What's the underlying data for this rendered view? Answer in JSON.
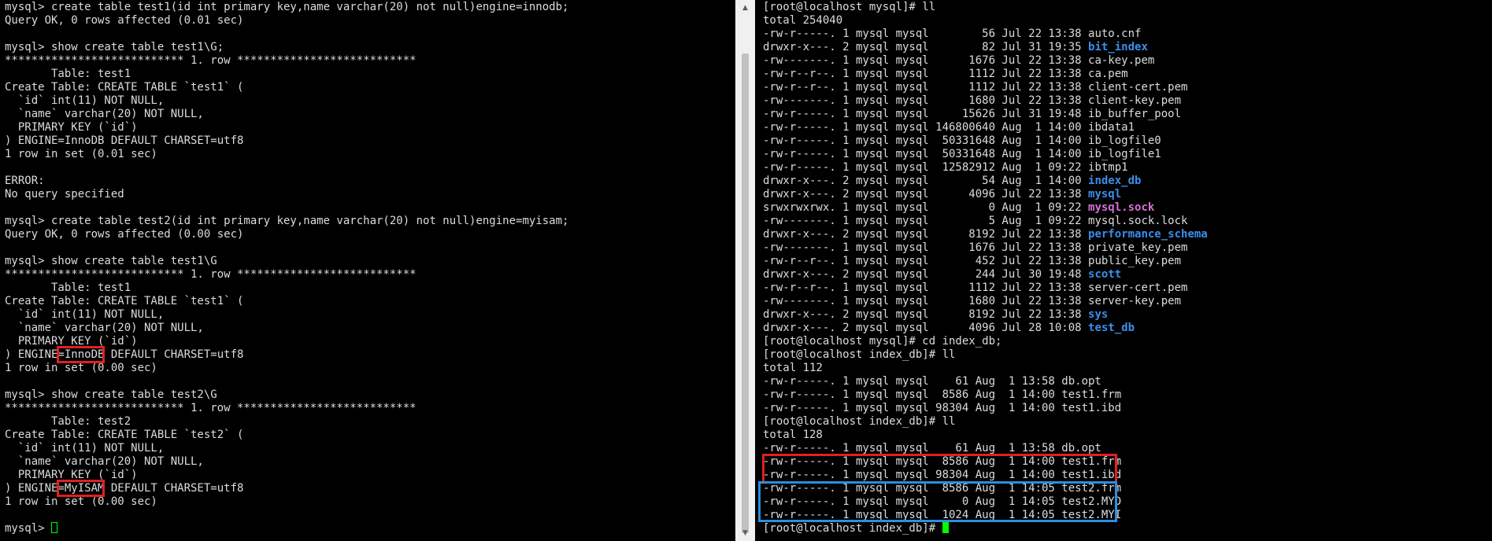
{
  "left_terminal": {
    "lines": [
      "mysql> create table test1(id int primary key,name varchar(20) not null)engine=innodb;",
      "Query OK, 0 rows affected (0.01 sec)",
      "",
      "mysql> show create table test1\\G;",
      "*************************** 1. row ***************************",
      "       Table: test1",
      "Create Table: CREATE TABLE `test1` (",
      "  `id` int(11) NOT NULL,",
      "  `name` varchar(20) NOT NULL,",
      "  PRIMARY KEY (`id`)",
      ") ENGINE=InnoDB DEFAULT CHARSET=utf8",
      "1 row in set (0.01 sec)",
      "",
      "ERROR:",
      "No query specified",
      "",
      "mysql> create table test2(id int primary key,name varchar(20) not null)engine=myisam;",
      "Query OK, 0 rows affected (0.00 sec)",
      "",
      "mysql> show create table test1\\G",
      "*************************** 1. row ***************************",
      "       Table: test1",
      "Create Table: CREATE TABLE `test1` (",
      "  `id` int(11) NOT NULL,",
      "  `name` varchar(20) NOT NULL,",
      "  PRIMARY KEY (`id`)",
      ") ENGINE=InnoDB DEFAULT CHARSET=utf8",
      "1 row in set (0.00 sec)",
      "",
      "mysql> show create table test2\\G",
      "*************************** 1. row ***************************",
      "       Table: test2",
      "Create Table: CREATE TABLE `test2` (",
      "  `id` int(11) NOT NULL,",
      "  `name` varchar(20) NOT NULL,",
      "  PRIMARY KEY (`id`)",
      ") ENGINE=MyISAM DEFAULT CHARSET=utf8",
      "1 row in set (0.00 sec)",
      ""
    ],
    "prompt": "mysql> "
  },
  "right_terminal": {
    "prompt1": "[root@localhost mysql]# ll",
    "total1": "total 254040",
    "listing1": [
      {
        "meta": "-rw-r-----. 1 mysql mysql        56 Jul 22 13:38 ",
        "name": "auto.cnf",
        "type": "file"
      },
      {
        "meta": "drwxr-x---. 2 mysql mysql        82 Jul 31 19:35 ",
        "name": "bit_index",
        "type": "dir"
      },
      {
        "meta": "-rw-------. 1 mysql mysql      1676 Jul 22 13:38 ",
        "name": "ca-key.pem",
        "type": "file"
      },
      {
        "meta": "-rw-r--r--. 1 mysql mysql      1112 Jul 22 13:38 ",
        "name": "ca.pem",
        "type": "file"
      },
      {
        "meta": "-rw-r--r--. 1 mysql mysql      1112 Jul 22 13:38 ",
        "name": "client-cert.pem",
        "type": "file"
      },
      {
        "meta": "-rw-------. 1 mysql mysql      1680 Jul 22 13:38 ",
        "name": "client-key.pem",
        "type": "file"
      },
      {
        "meta": "-rw-r-----. 1 mysql mysql     15626 Jul 31 19:48 ",
        "name": "ib_buffer_pool",
        "type": "file"
      },
      {
        "meta": "-rw-r-----. 1 mysql mysql 146800640 Aug  1 14:00 ",
        "name": "ibdata1",
        "type": "file"
      },
      {
        "meta": "-rw-r-----. 1 mysql mysql  50331648 Aug  1 14:00 ",
        "name": "ib_logfile0",
        "type": "file"
      },
      {
        "meta": "-rw-r-----. 1 mysql mysql  50331648 Aug  1 14:00 ",
        "name": "ib_logfile1",
        "type": "file"
      },
      {
        "meta": "-rw-r-----. 1 mysql mysql  12582912 Aug  1 09:22 ",
        "name": "ibtmp1",
        "type": "file"
      },
      {
        "meta": "drwxr-x---. 2 mysql mysql        54 Aug  1 14:00 ",
        "name": "index_db",
        "type": "dir"
      },
      {
        "meta": "drwxr-x---. 2 mysql mysql      4096 Jul 22 13:38 ",
        "name": "mysql",
        "type": "dir"
      },
      {
        "meta": "srwxrwxrwx. 1 mysql mysql         0 Aug  1 09:22 ",
        "name": "mysql.sock",
        "type": "sock"
      },
      {
        "meta": "-rw-------. 1 mysql mysql         5 Aug  1 09:22 ",
        "name": "mysql.sock.lock",
        "type": "file"
      },
      {
        "meta": "drwxr-x---. 2 mysql mysql      8192 Jul 22 13:38 ",
        "name": "performance_schema",
        "type": "dir"
      },
      {
        "meta": "-rw-------. 1 mysql mysql      1676 Jul 22 13:38 ",
        "name": "private_key.pem",
        "type": "file"
      },
      {
        "meta": "-rw-r--r--. 1 mysql mysql       452 Jul 22 13:38 ",
        "name": "public_key.pem",
        "type": "file"
      },
      {
        "meta": "drwxr-x---. 2 mysql mysql       244 Jul 30 19:48 ",
        "name": "scott",
        "type": "dir"
      },
      {
        "meta": "-rw-r--r--. 1 mysql mysql      1112 Jul 22 13:38 ",
        "name": "server-cert.pem",
        "type": "file"
      },
      {
        "meta": "-rw-------. 1 mysql mysql      1680 Jul 22 13:38 ",
        "name": "server-key.pem",
        "type": "file"
      },
      {
        "meta": "drwxr-x---. 2 mysql mysql      8192 Jul 22 13:38 ",
        "name": "sys",
        "type": "dir"
      },
      {
        "meta": "drwxr-x---. 2 mysql mysql      4096 Jul 28 10:08 ",
        "name": "test_db",
        "type": "dir"
      }
    ],
    "tail_lines": [
      "[root@localhost mysql]# cd index_db;",
      "[root@localhost index_db]# ll",
      "total 112",
      "-rw-r-----. 1 mysql mysql    61 Aug  1 13:58 db.opt",
      "-rw-r-----. 1 mysql mysql  8586 Aug  1 14:00 test1.frm",
      "-rw-r-----. 1 mysql mysql 98304 Aug  1 14:00 test1.ibd",
      "[root@localhost index_db]# ll",
      "total 128",
      "-rw-r-----. 1 mysql mysql    61 Aug  1 13:58 db.opt",
      "-rw-r-----. 1 mysql mysql  8586 Aug  1 14:00 test1.frm",
      "-rw-r-----. 1 mysql mysql 98304 Aug  1 14:00 test1.ibd",
      "-rw-r-----. 1 mysql mysql  8586 Aug  1 14:05 test2.frm",
      "-rw-r-----. 1 mysql mysql     0 Aug  1 14:05 test2.MYD",
      "-rw-r-----. 1 mysql mysql  1024 Aug  1 14:05 test2.MYI"
    ],
    "final_prompt": "[root@localhost index_db]# "
  },
  "scrollbar": {
    "up_arrow": "▲",
    "down_arrow": "▼"
  },
  "colors": {
    "background": "#000000",
    "text": "#dcdcdc",
    "directory": "#3b8eea",
    "socket": "#d670d6",
    "cursor": "#00ff00",
    "highlight_red": "#e02020",
    "highlight_blue": "#2a8ee0"
  },
  "icons": {
    "scroll_up": "triangle-up-icon",
    "scroll_down": "triangle-down-icon"
  }
}
